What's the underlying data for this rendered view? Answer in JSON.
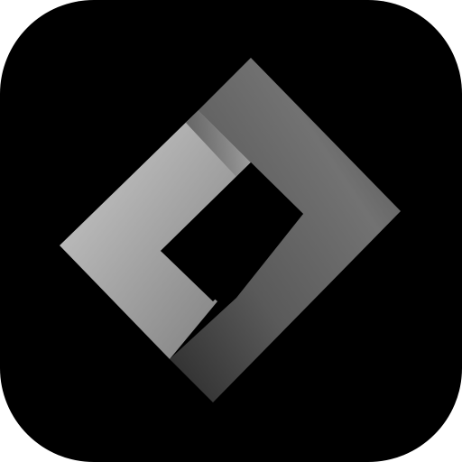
{
  "app_icon": {
    "logo": "diamond-frame-logo",
    "colors": {
      "tile_background": "#000000",
      "logo_left_light": "#bdbdbd",
      "logo_left_mid": "#8f8f8f",
      "logo_right_dark": "#434343",
      "logo_right_mid": "#6a6a6a",
      "logo_inner_hole": "#000000"
    }
  }
}
